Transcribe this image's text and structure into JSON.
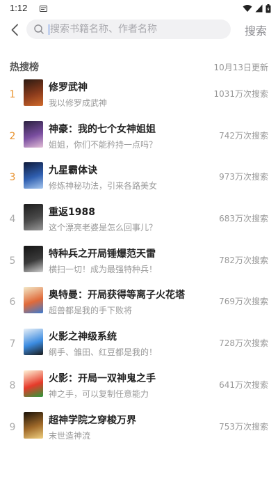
{
  "status": {
    "time": "1:12"
  },
  "search": {
    "placeholder": "搜索书籍名称、作者名称",
    "button": "搜索"
  },
  "hot": {
    "title": "热搜榜",
    "updated": "10月13日更新"
  },
  "books": [
    {
      "rank": "1",
      "title": "修罗武神",
      "desc": "我以修罗成武神",
      "heat": "1031万次搜索",
      "cover_colors": [
        "#2a1a12",
        "#8a3b1c",
        "#d06a2b"
      ]
    },
    {
      "rank": "2",
      "title": "神豪：我的七个女神姐姐",
      "desc": "姐姐，你们不能矜持一点吗？",
      "heat": "742万次搜索",
      "cover_colors": [
        "#2b2140",
        "#7a4ea0",
        "#e4c0d8"
      ]
    },
    {
      "rank": "3",
      "title": "九星霸体诀",
      "desc": "修炼神秘功法，引来各路美女",
      "heat": "973万次搜索",
      "cover_colors": [
        "#0f1a3a",
        "#2f5fb0",
        "#a8c8f0"
      ]
    },
    {
      "rank": "4",
      "title": "重返1988",
      "desc": "这个漂亮老婆是怎么回事儿？",
      "heat": "683万次搜索",
      "cover_colors": [
        "#1c1c1c",
        "#4a4a4a",
        "#9a9a9a"
      ]
    },
    {
      "rank": "5",
      "title": "特种兵之开局锤爆范天雷",
      "desc": "横扫一切！成为最强特种兵！",
      "heat": "782万次搜索",
      "cover_colors": [
        "#141414",
        "#3a3a3a",
        "#cfcfcf"
      ]
    },
    {
      "rank": "6",
      "title": "奥特曼：开局获得等离子火花塔",
      "desc": "超兽都是我的手下败将",
      "heat": "769万次搜索",
      "cover_colors": [
        "#f3e9c8",
        "#e06a3a",
        "#3a7ad0"
      ]
    },
    {
      "rank": "7",
      "title": "火影之神级系统",
      "desc": "纲手、雏田、红豆都是我的！",
      "heat": "728万次搜索",
      "cover_colors": [
        "#e8f0f8",
        "#3b8be0",
        "#1a1a1a"
      ]
    },
    {
      "rank": "8",
      "title": "火影：开局一双神鬼之手",
      "desc": "神之手，可以复制任意能力",
      "heat": "641万次搜索",
      "cover_colors": [
        "#fff4d8",
        "#e63a2a",
        "#2a9a3a"
      ]
    },
    {
      "rank": "9",
      "title": "超神学院之穿梭万界",
      "desc": "末世造神流",
      "heat": "753万次搜索",
      "cover_colors": [
        "#1a1208",
        "#a06a2a",
        "#f0d080"
      ]
    }
  ],
  "icons": {
    "back": "chevron-left-icon",
    "search": "magnifier-icon",
    "wifi": "wifi-icon",
    "signal": "signal-icon",
    "battery": "battery-icon",
    "notification": "notification-icon"
  },
  "colors": {
    "accent_rank": "#e8922e",
    "search_bg": "#f1f1f3",
    "cursor": "#4a7de0"
  }
}
